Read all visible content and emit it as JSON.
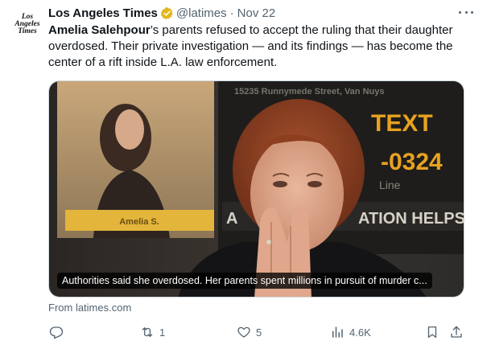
{
  "account": {
    "avatar_line1": "Los",
    "avatar_line2": "Angeles",
    "avatar_line3": "Times",
    "display_name": "Los Angeles Times",
    "handle": "@latimes",
    "separator": "·",
    "date": "Nov 22"
  },
  "post": {
    "highlight": "Amelia Salehpour",
    "text": "’s parents refused to accept the ruling that their daughter overdosed. Their private investigation — and its findings — has become the center of a rift inside L.A. law enforcement."
  },
  "media": {
    "caption": "Authorities said she overdosed. Her parents spent millions in pursuit of murder c...",
    "banner_name": "Amelia S.",
    "banner_text1": "TEXT",
    "banner_text2": "-0324",
    "banner_text3": "ATION HELPS",
    "banner_text4": "A",
    "banner_address": "15235 Runnymede Street, Van Nuys",
    "banner_line": "Line"
  },
  "source": "From latimes.com",
  "metrics": {
    "replies": "",
    "reposts": "1",
    "likes": "5",
    "views": "4.6K"
  },
  "colors": {
    "verified": "#e2b719",
    "secondary_text": "#536471",
    "primary_text": "#0f1419"
  }
}
